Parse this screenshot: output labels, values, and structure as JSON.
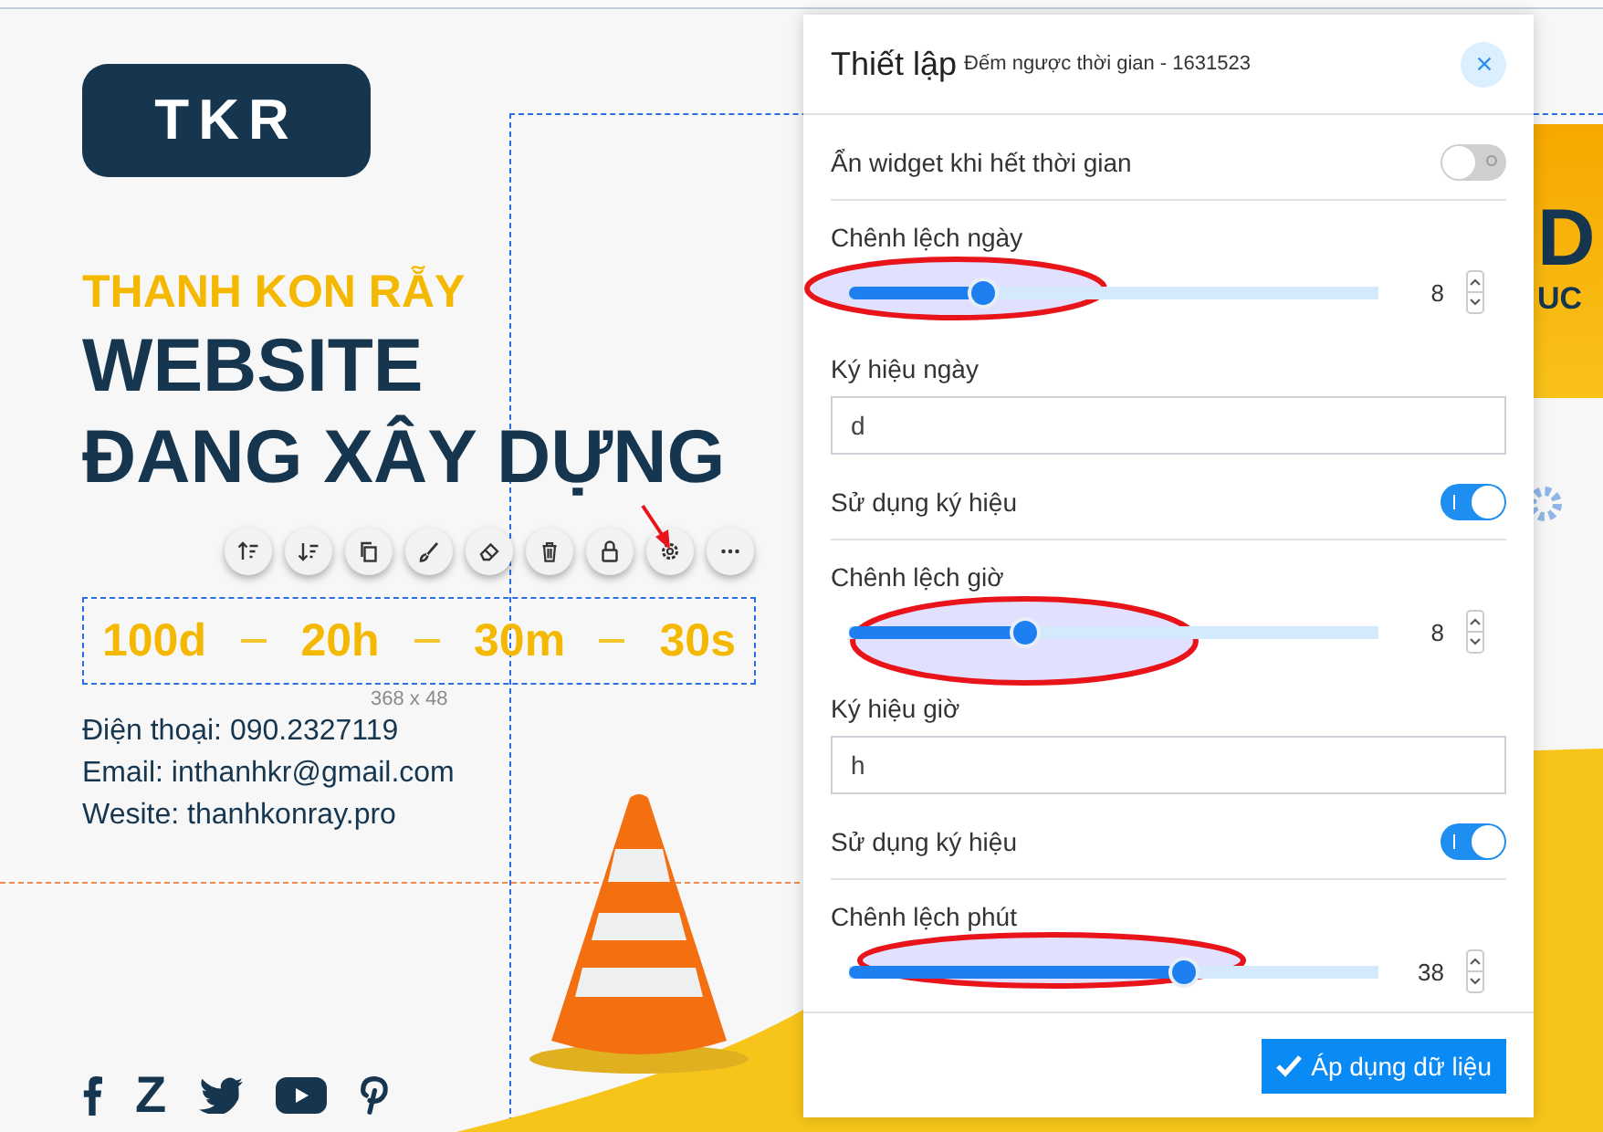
{
  "logo": {
    "text": "TKR"
  },
  "brand": "THANH KON RẴY",
  "headline": [
    "WEBSITE",
    "ĐANG XÂY DỰNG"
  ],
  "countdown": {
    "units": [
      "100d",
      "20h",
      "30m",
      "30s"
    ],
    "size_label": "368 x 48"
  },
  "contact": [
    "Điện thoại: 090.2327119",
    "Email: inthanhkr@gmail.com",
    "Wesite: thanhkonray.pro"
  ],
  "social": [
    {
      "kind": "facebook"
    },
    {
      "kind": "zalo",
      "label": "Z"
    },
    {
      "kind": "twitter"
    },
    {
      "kind": "youtube"
    },
    {
      "kind": "pinterest"
    }
  ],
  "sign": [
    "D",
    "UC"
  ],
  "panel": {
    "title": "Thiết lập",
    "subtitle": "Đếm ngược thời gian - 1631523",
    "items": [
      {
        "kind": "toggle",
        "label": "Ẩn widget khi hết thời gian",
        "on": false
      },
      {
        "kind": "slider",
        "label": "Chênh lệch ngày",
        "level": 0.25,
        "reading": "8"
      },
      {
        "kind": "field",
        "label": "Ký hiệu ngày",
        "value": "d"
      },
      {
        "kind": "toggle",
        "label": "Sử dụng ký hiệu",
        "on": true
      },
      {
        "kind": "slider",
        "label": "Chênh lệch giờ",
        "level": 0.33,
        "reading": "8"
      },
      {
        "kind": "field",
        "label": "Ký hiệu giờ",
        "value": "h"
      },
      {
        "kind": "toggle",
        "label": "Sử dụng ký hiệu",
        "on": true
      },
      {
        "kind": "slider",
        "label": "Chênh lệch phút",
        "level": 0.63,
        "reading": "38"
      }
    ],
    "apply_button": "Áp dụng dữ liệu"
  }
}
